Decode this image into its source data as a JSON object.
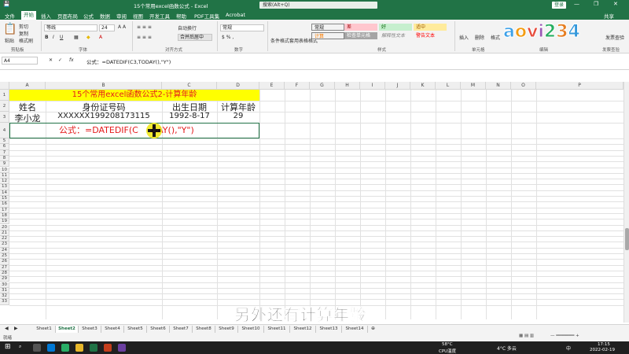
{
  "window": {
    "title": "15个常用excel函数公式 - Excel",
    "search": "搜索(Alt+Q)",
    "login": "登录",
    "share": "共享"
  },
  "menu": [
    "文件",
    "开始",
    "插入",
    "页面布局",
    "公式",
    "数据",
    "审阅",
    "视图",
    "开发工具",
    "帮助",
    "PDF工具集",
    "Acrobat"
  ],
  "ribbon": {
    "paste": "粘贴",
    "cut": "剪切",
    "copy": "复制",
    "format_painter": "格式刷",
    "clipboard": "剪贴板",
    "font_name": "等线",
    "font_size": "24",
    "font_group": "字体",
    "wrap": "自动换行",
    "merge": "合并后居中",
    "align_group": "对齐方式",
    "number_format": "常规",
    "number_group": "数字",
    "cond_format": "条件格式",
    "table_format": "套用表格格式",
    "styles": [
      {
        "label": "常规",
        "bg": "#ffffff",
        "fg": "#000000"
      },
      {
        "label": "差",
        "bg": "#ffc7ce",
        "fg": "#9c0006"
      },
      {
        "label": "好",
        "bg": "#c6efce",
        "fg": "#006100"
      },
      {
        "label": "适中",
        "bg": "#ffeb9c",
        "fg": "#9c5700"
      },
      {
        "label": "计算",
        "bg": "#f2f2f2",
        "fg": "#fa7d00"
      },
      {
        "label": "检查单元格",
        "bg": "#a5a5a5",
        "fg": "#ffffff"
      },
      {
        "label": "解释性文本",
        "bg": "#ffffff",
        "fg": "#7f7f7f"
      },
      {
        "label": "警告文本",
        "bg": "#ffffff",
        "fg": "#ff0000"
      }
    ],
    "style_group": "样式",
    "insert": "插入",
    "delete": "删除",
    "format": "格式",
    "cells_group": "单元格",
    "autosum": "自动求和",
    "fill": "填充",
    "clear": "清除",
    "edit_group": "编辑",
    "sort": "排序和筛选",
    "find": "查找和选择",
    "invoice": "发票查验",
    "invoice_group": "发票查验"
  },
  "logo": "aovi234",
  "formula_bar": {
    "name_box": "A4",
    "content": "公式：=DATEDIF(C3,TODAY(),\"Y\")"
  },
  "columns": [
    "A",
    "B",
    "C",
    "D",
    "E",
    "F",
    "G",
    "H",
    "I",
    "J",
    "K",
    "L",
    "M",
    "N",
    "O",
    "P"
  ],
  "rows": [
    "1",
    "2",
    "3",
    "4",
    "5",
    "6",
    "7",
    "8",
    "9",
    "10",
    "11",
    "12",
    "13",
    "14",
    "15",
    "16",
    "17",
    "18",
    "19",
    "20",
    "21",
    "22",
    "23",
    "24",
    "25",
    "26",
    "27",
    "28",
    "29",
    "30",
    "31",
    "32",
    "33"
  ],
  "cells": {
    "banner": "15个常用excel函数公式2-计算年龄",
    "a2": "姓名",
    "b2": "身份证号码",
    "c2": "出生日期",
    "d2": "计算年龄",
    "a3": "李小龙",
    "b3": "XXXXXX199208173115",
    "c3": "1992-8-17",
    "d3": "29",
    "formula_prefix": "公式：",
    "formula_text": "=DATEDIF(C",
    "formula_tail": "DAY(),\"Y\")"
  },
  "subtitle": "另外还有计算年龄",
  "sheets": [
    "Sheet1",
    "Sheet2",
    "Sheet3",
    "Sheet4",
    "Sheet5",
    "Sheet6",
    "Sheet7",
    "Sheet8",
    "Sheet9",
    "Sheet10",
    "Sheet11",
    "Sheet12",
    "Sheet13",
    "Sheet14"
  ],
  "active_sheet": "Sheet2",
  "status": {
    "ready": "就绪"
  },
  "taskbar": {
    "temp": "58°C",
    "cpu": "CPU温度",
    "weather": "4°C 多云",
    "lang": "中",
    "time": "17:15",
    "date": "2022-02-19"
  }
}
